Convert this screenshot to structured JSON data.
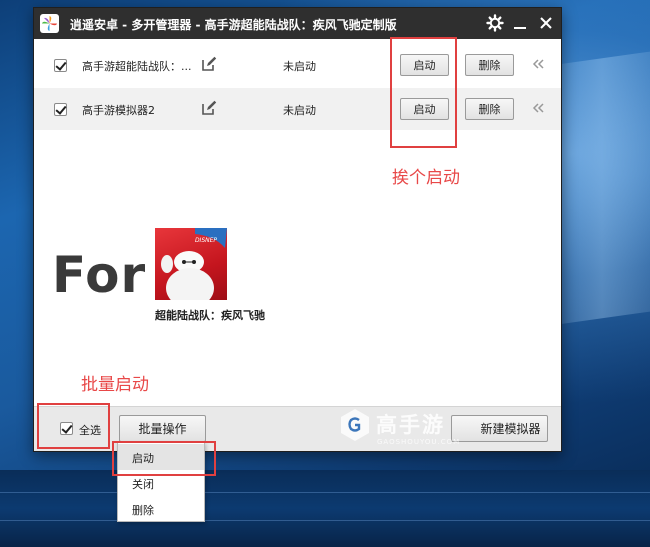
{
  "window": {
    "title": "逍遥安卓 - 多开管理器 - 高手游超能陆战队：疾风飞驰定制版",
    "icons": [
      "app-logo-icon",
      "gear-icon",
      "minimize-icon",
      "close-icon"
    ]
  },
  "instances": [
    {
      "name": "高手游超能陆战队：...",
      "status": "未启动",
      "start_label": "启动",
      "delete_label": "删除"
    },
    {
      "name": "高手游模拟器2",
      "status": "未启动",
      "start_label": "启动",
      "delete_label": "删除"
    }
  ],
  "annotations": {
    "swap_start": "挨个启动",
    "batch_start": "批量启动"
  },
  "promo": {
    "for_text": "For",
    "game_name": "超能陆战队：疾风飞驰",
    "icon_badge": "DISNEP"
  },
  "bottom": {
    "select_all_label": "全选",
    "batch_ops_label": "批量操作",
    "new_emulator_label": "新建模拟器"
  },
  "batch_menu": {
    "items": [
      "启动",
      "关闭",
      "删除"
    ]
  },
  "watermark": {
    "text": "高手游",
    "sub": "GAOSHOUYOU.COM"
  },
  "colors": {
    "annotation_red": "#e04040",
    "titlebar": "#2f2f2f"
  }
}
